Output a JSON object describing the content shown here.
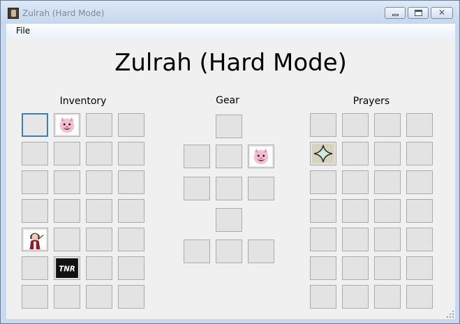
{
  "window": {
    "title": "Zulrah (Hard Mode)",
    "buttons": {
      "minimize": "minimize",
      "maximize": "maximize",
      "close": "✕"
    }
  },
  "menu": {
    "file": "File"
  },
  "main": {
    "title": "Zulrah (Hard Mode)"
  },
  "sections": {
    "inventory": {
      "label": "Inventory",
      "rows": 7,
      "cols": 4,
      "selected_slot": 0,
      "items": [
        {
          "slot": 1,
          "icon": "pet-portrait-icon"
        },
        {
          "slot": 16,
          "icon": "character-portrait-icon"
        },
        {
          "slot": 21,
          "icon": "tnr-logo-icon"
        }
      ]
    },
    "gear": {
      "label": "Gear",
      "slots": [
        "head",
        "cape",
        "neck",
        "ammo",
        "weapon",
        "body",
        "shield",
        "legs",
        "hands",
        "feet",
        "ring"
      ],
      "items": [
        {
          "slot": "ammo",
          "icon": "pet-portrait-icon"
        }
      ]
    },
    "prayers": {
      "label": "Prayers",
      "rows": 7,
      "cols": 4,
      "items": [
        {
          "slot": 4,
          "icon": "prayer-star-icon"
        }
      ]
    }
  },
  "colors": {
    "slot_bg": "#e3e3e3",
    "slot_border": "#ababab",
    "selected_border": "#3c7fb1",
    "client_bg": "#f0f0f0"
  }
}
